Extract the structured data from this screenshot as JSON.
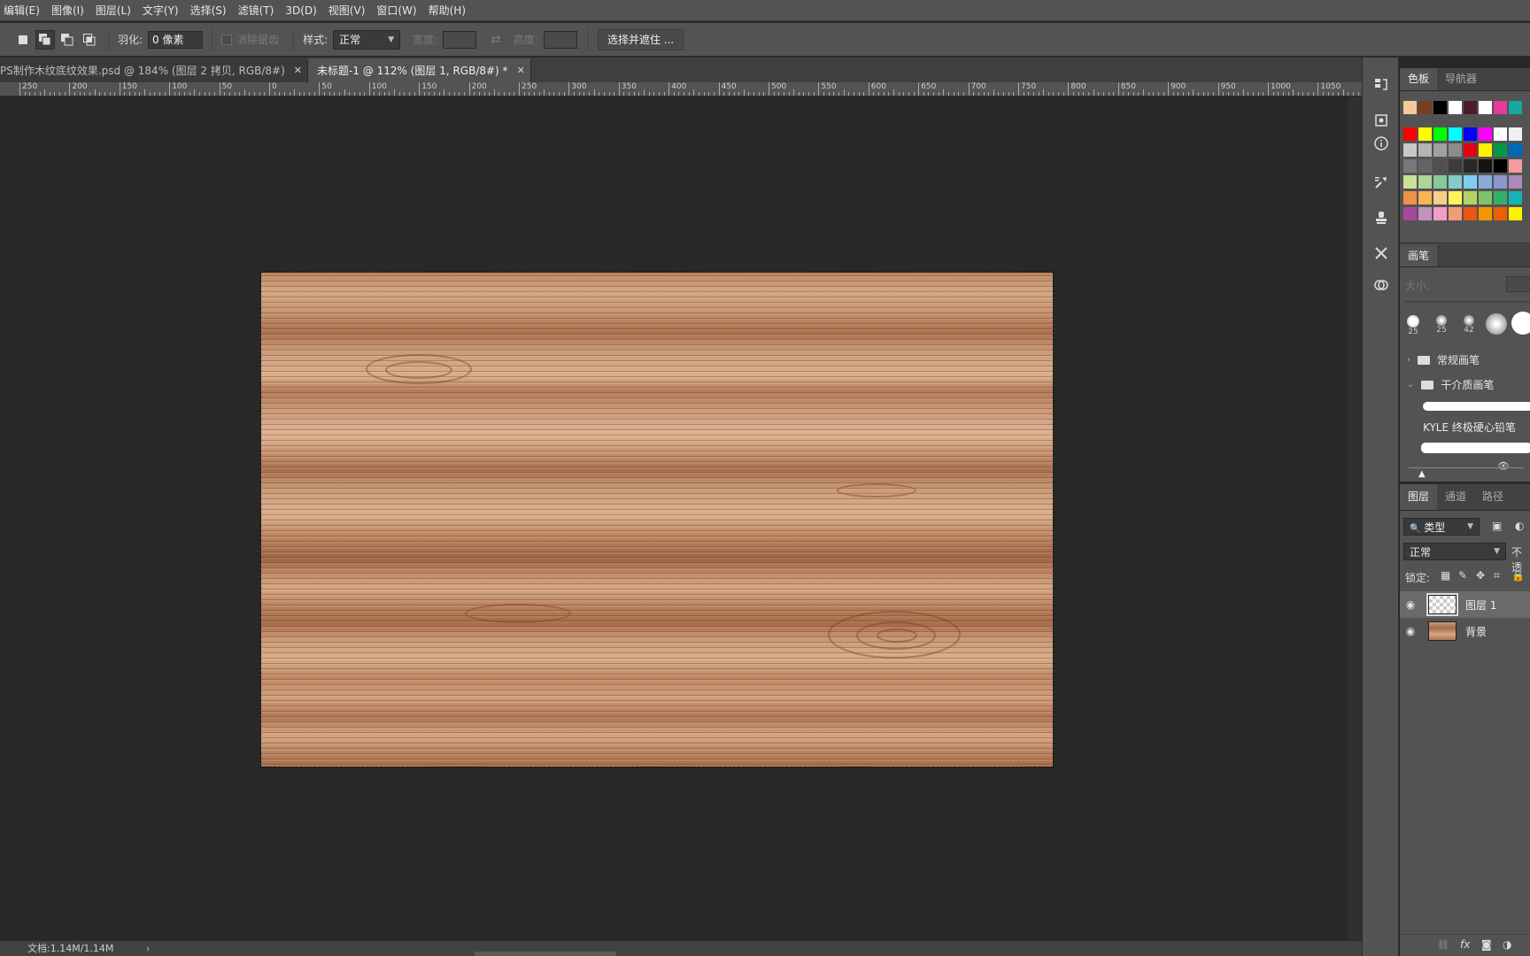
{
  "menu": [
    "编辑(E)",
    "图像(I)",
    "图层(L)",
    "文字(Y)",
    "选择(S)",
    "滤镜(T)",
    "3D(D)",
    "视图(V)",
    "窗口(W)",
    "帮助(H)"
  ],
  "options": {
    "feather_label": "羽化:",
    "feather_value": "0 像素",
    "antialias_label": "消除锯齿",
    "style_label": "样式:",
    "style_value": "正常",
    "width_label": "宽度:",
    "height_label": "高度:",
    "swap_icon": "swap-arrows-icon",
    "select_mask_button": "选择并遮住 ..."
  },
  "tabs": [
    {
      "label": "PS制作木纹底纹效果.psd @ 184% (图层 2 拷贝, RGB/8#)",
      "active": false
    },
    {
      "label": "未标题-1 @ 112% (图层 1, RGB/8#) *",
      "active": true
    }
  ],
  "ruler": {
    "labels": [
      "250",
      "200",
      "150",
      "100",
      "50",
      "0",
      "50",
      "100",
      "150",
      "200",
      "250",
      "300",
      "350",
      "400",
      "450",
      "500",
      "550",
      "600",
      "650",
      "700",
      "750",
      "800",
      "850",
      "900",
      "950",
      "1000",
      "1050"
    ]
  },
  "status": {
    "doc": "文档:1.14M/1.14M",
    "arrow": "›"
  },
  "swatches_panel": {
    "tabs": [
      "色板",
      "导航器"
    ],
    "recent": [
      "#f6c99a",
      "#7a3e1e",
      "#000000",
      "#ffffff",
      "#4a1c2c",
      "#ffffff",
      "#e83a9a",
      "#16a8a0"
    ],
    "rows": [
      [
        "#ff0000",
        "#ffff00",
        "#00ff00",
        "#00ffff",
        "#0000ff",
        "#ff00ff",
        "#ffffff",
        "#f0f0f0"
      ],
      [
        "#c8c8c8",
        "#b4b4b4",
        "#a0a0a0",
        "#8c8c8c",
        "#e60012",
        "#fff100",
        "#009944",
        "#0068b7"
      ],
      [
        "#787878",
        "#646464",
        "#505050",
        "#3c3c3c",
        "#282828",
        "#141414",
        "#000000",
        "#f29c9f"
      ],
      [
        "#cce198",
        "#acd598",
        "#89c997",
        "#84ccc9",
        "#7ecef4",
        "#88abda",
        "#8c97cb",
        "#aa89bd"
      ],
      [
        "#f19149",
        "#f8b551",
        "#facd89",
        "#fff45c",
        "#b3d465",
        "#80c269",
        "#32b16c",
        "#13b5b1"
      ],
      [
        "#a5489f",
        "#c490bf",
        "#f19ec2",
        "#f29b76",
        "#ea5514",
        "#f39800",
        "#eb6100",
        "#fff100"
      ]
    ]
  },
  "brush_panel": {
    "tab": "画笔",
    "size_label": "大小:",
    "tips": [
      "25",
      "25",
      "42",
      "",
      ""
    ],
    "folder_general": "常规画笔",
    "folder_dry": "干介质画笔",
    "brush_name": "KYLE 终极硬心铅笔"
  },
  "layers_panel": {
    "tabs": [
      "图层",
      "通道",
      "路径"
    ],
    "filter_label": "类型",
    "blend_mode": "正常",
    "opacity_label": "不透",
    "lock_label": "锁定:",
    "layers": [
      {
        "name": "图层 1",
        "active": true
      },
      {
        "name": "背景",
        "active": false
      }
    ]
  }
}
